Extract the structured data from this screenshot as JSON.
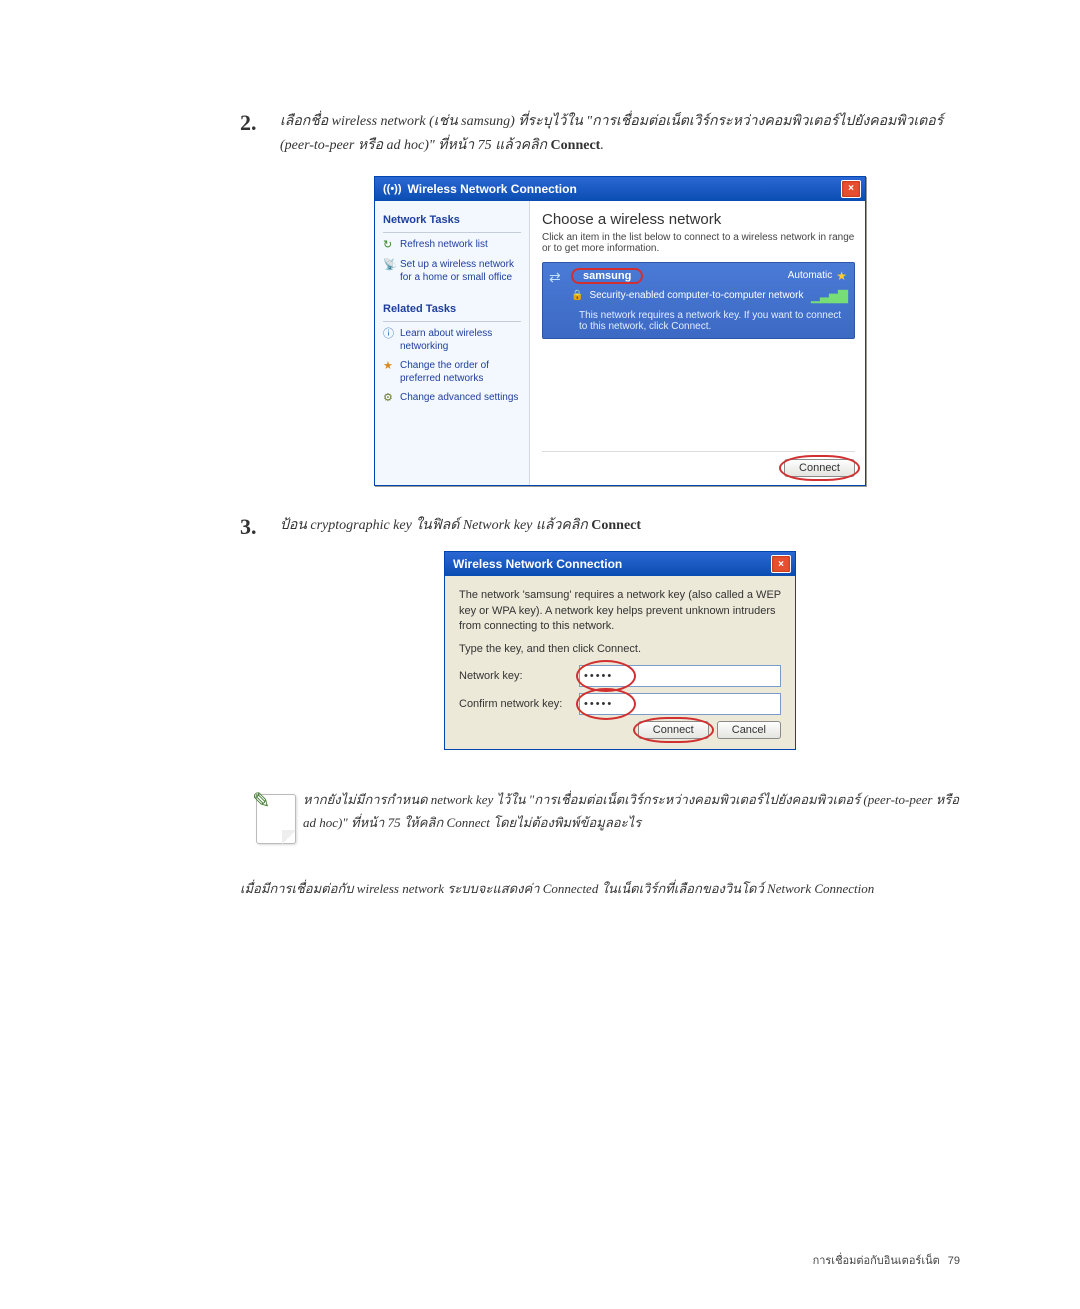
{
  "steps": {
    "s2": {
      "num": "2.",
      "text_pre": "เลือกชื่อ wireless network (เช่น samsung) ที่ระบุไว้ใน \"การเชื่อมต่อเน็ตเวิร์กระหว่างคอมพิวเตอร์ไปยังคอมพิวเตอร์ (peer-to-peer หรือ ad hoc)\" ที่หน้า 75 แล้วคลิก ",
      "text_bold": "Connect"
    },
    "s3": {
      "num": "3.",
      "text_pre": "ป้อน cryptographic key ในฟิลด์ Network key แล้วคลิก ",
      "text_bold": "Connect"
    }
  },
  "win1": {
    "title": "Wireless Network Connection",
    "left": {
      "sec1": "Network Tasks",
      "t1": "Refresh network list",
      "t2": "Set up a wireless network for a home or small office",
      "sec2": "Related Tasks",
      "t3": "Learn about wireless networking",
      "t4": "Change the order of preferred networks",
      "t5": "Change advanced settings"
    },
    "right": {
      "title": "Choose a wireless network",
      "desc": "Click an item in the list below to connect to a wireless network in range or to get more information.",
      "ssid": "samsung",
      "auto": "Automatic",
      "sec": "Security-enabled computer-to-computer network",
      "hint": "This network requires a network key. If you want to connect to this network, click Connect.",
      "connect": "Connect"
    }
  },
  "dlg": {
    "title": "Wireless Network Connection",
    "desc": "The network 'samsung' requires a network key (also called a WEP key or WPA key). A network key helps prevent unknown intruders from connecting to this network.",
    "sub": "Type the key, and then click Connect.",
    "l1": "Network key:",
    "l2": "Confirm network key:",
    "val": "•••••",
    "connect": "Connect",
    "cancel": "Cancel"
  },
  "note": "หากยังไม่มีการกำหนด network key ไว้ใน \"การเชื่อมต่อเน็ตเวิร์กระหว่างคอมพิวเตอร์ไปยังคอมพิวเตอร์ (peer-to-peer หรือ ad hoc)\" ที่หน้า 75 ให้คลิก Connect โดยไม่ต้องพิมพ์ข้อมูลอะไร",
  "after": "เมื่อมีการเชื่อมต่อกับ wireless network ระบบจะแสดงค่า Connected ในเน็ตเวิร์กที่เลือกของวินโดว์ Network Connection",
  "footer": {
    "label": "การเชื่อมต่อกับอินเตอร์เน็ต",
    "page": "79"
  }
}
